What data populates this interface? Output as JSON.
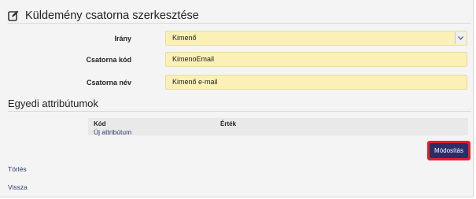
{
  "page": {
    "title": "Küldemény csatorna szerkesztése",
    "title_icon": "edit-icon"
  },
  "form": {
    "direction": {
      "label": "Irány",
      "value": "Kimenő"
    },
    "channel_code": {
      "label": "Csatorna kód",
      "value": "KimenoEmail"
    },
    "channel_name": {
      "label": "Csatorna név",
      "value": "Kimenő e-mail"
    }
  },
  "attributes": {
    "title": "Egyedi attribútumok",
    "columns": {
      "code": "Kód",
      "value": "Érték"
    },
    "add_link": "Új attribútum"
  },
  "actions": {
    "modify": "Módosítás",
    "delete": "Törlés",
    "back": "Vissza"
  },
  "colors": {
    "field_bg": "#fbf1b7",
    "button_bg": "#2b2d6b",
    "button_highlight": "#e0202a",
    "link": "#2b3b6b"
  }
}
